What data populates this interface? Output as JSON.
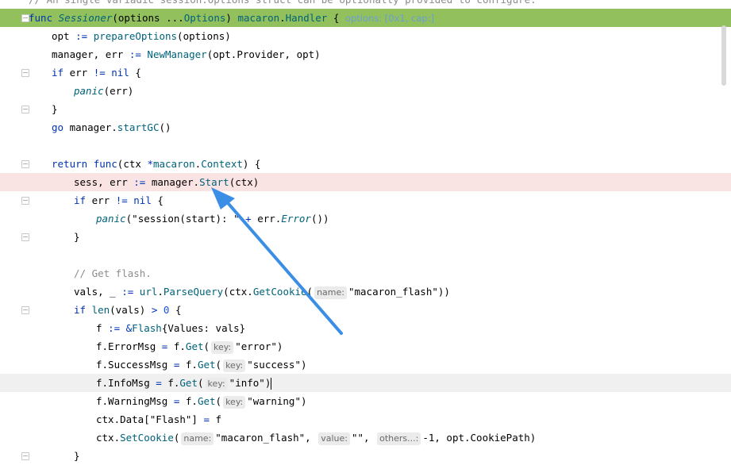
{
  "lines": [
    {
      "id": "l0",
      "tokens": [
        {
          "t": "// An single variadic session.Options struct can be optionally provided to configure.",
          "c": "cmt"
        }
      ]
    },
    {
      "id": "l1",
      "tokens": [
        {
          "t": "func ",
          "c": "kw"
        },
        {
          "t": "Sessioner",
          "c": "fni"
        },
        {
          "t": "(options ...",
          "c": "op"
        },
        {
          "t": "Options",
          "c": "pkg"
        },
        {
          "t": ") ",
          "c": "op"
        },
        {
          "t": "macaron",
          "c": "pkg"
        },
        {
          "t": ".",
          "c": "op"
        },
        {
          "t": "Handler",
          "c": "pkg"
        },
        {
          "t": " { ",
          "c": "op"
        }
      ],
      "hint": "options: [0x1, cap:]"
    },
    {
      "id": "l2",
      "indent": 1,
      "tokens": [
        {
          "t": "opt ",
          "c": "op"
        },
        {
          "t": ":= ",
          "c": "kwo"
        },
        {
          "t": "prepareOptions",
          "c": "call"
        },
        {
          "t": "(options)",
          "c": "op"
        }
      ]
    },
    {
      "id": "l3",
      "indent": 1,
      "tokens": [
        {
          "t": "manager, err ",
          "c": "op"
        },
        {
          "t": ":= ",
          "c": "kwo"
        },
        {
          "t": "NewManager",
          "c": "call"
        },
        {
          "t": "(opt.Provider, opt)",
          "c": "op"
        }
      ]
    },
    {
      "id": "l4",
      "indent": 1,
      "tokens": [
        {
          "t": "if ",
          "c": "kw"
        },
        {
          "t": "err ",
          "c": "op"
        },
        {
          "t": "!= ",
          "c": "kwo"
        },
        {
          "t": "nil",
          "c": "kw"
        },
        {
          "t": " {",
          "c": "op"
        }
      ]
    },
    {
      "id": "l5",
      "indent": 2,
      "tokens": [
        {
          "t": "panic",
          "c": "ital"
        },
        {
          "t": "(err)",
          "c": "op"
        }
      ]
    },
    {
      "id": "l6",
      "indent": 1,
      "tokens": [
        {
          "t": "}",
          "c": "op"
        }
      ]
    },
    {
      "id": "l7",
      "indent": 1,
      "tokens": [
        {
          "t": "go ",
          "c": "kw"
        },
        {
          "t": "manager.",
          "c": "op"
        },
        {
          "t": "startGC",
          "c": "call"
        },
        {
          "t": "()",
          "c": "op"
        }
      ]
    },
    {
      "id": "l8",
      "indent": 0,
      "tokens": []
    },
    {
      "id": "l9",
      "indent": 1,
      "tokens": [
        {
          "t": "return ",
          "c": "kw"
        },
        {
          "t": "func",
          "c": "kw"
        },
        {
          "t": "(ctx ",
          "c": "op"
        },
        {
          "t": "*",
          "c": "kwo"
        },
        {
          "t": "macaron",
          "c": "pkg"
        },
        {
          "t": ".",
          "c": "op"
        },
        {
          "t": "Context",
          "c": "pkg"
        },
        {
          "t": ") {",
          "c": "op"
        }
      ]
    },
    {
      "id": "l10",
      "indent": 2,
      "tokens": [
        {
          "t": "sess, err ",
          "c": "op"
        },
        {
          "t": ":= ",
          "c": "kwo"
        },
        {
          "t": "manager.",
          "c": "op"
        },
        {
          "t": "Start",
          "c": "call"
        },
        {
          "t": "(ctx)",
          "c": "op"
        }
      ]
    },
    {
      "id": "l11",
      "indent": 2,
      "tokens": [
        {
          "t": "if ",
          "c": "kw"
        },
        {
          "t": "err ",
          "c": "op"
        },
        {
          "t": "!= ",
          "c": "kwo"
        },
        {
          "t": "nil",
          "c": "kw"
        },
        {
          "t": " {",
          "c": "op"
        }
      ]
    },
    {
      "id": "l12",
      "indent": 3,
      "tokens": [
        {
          "t": "panic",
          "c": "ital"
        },
        {
          "t": "(\"session(start): \" ",
          "c": "op"
        },
        {
          "t": "+ ",
          "c": "kwo"
        },
        {
          "t": "err.",
          "c": "op"
        },
        {
          "t": "Error",
          "c": "ital"
        },
        {
          "t": "())",
          "c": "op"
        }
      ]
    },
    {
      "id": "l13",
      "indent": 2,
      "tokens": [
        {
          "t": "}",
          "c": "op"
        }
      ]
    },
    {
      "id": "l14",
      "indent": 0,
      "tokens": []
    },
    {
      "id": "l15",
      "indent": 2,
      "tokens": [
        {
          "t": "// Get flash.",
          "c": "cmt"
        }
      ]
    },
    {
      "id": "l16",
      "indent": 2,
      "tokens": [
        {
          "t": "vals, _ ",
          "c": "op"
        },
        {
          "t": ":= ",
          "c": "kwo"
        },
        {
          "t": "url",
          "c": "pkg"
        },
        {
          "t": ".",
          "c": "op"
        },
        {
          "t": "ParseQuery",
          "c": "call"
        },
        {
          "t": "(ctx.",
          "c": "op"
        },
        {
          "t": "GetCookie",
          "c": "call"
        },
        {
          "t": "(",
          "c": "op"
        },
        {
          "h": "name:"
        },
        {
          "t": "\"macaron_flash\"",
          "c": "op"
        },
        {
          "t": "))",
          "c": "op"
        }
      ]
    },
    {
      "id": "l17",
      "indent": 2,
      "tokens": [
        {
          "t": "if ",
          "c": "kw"
        },
        {
          "t": "len",
          "c": "call"
        },
        {
          "t": "(vals) ",
          "c": "op"
        },
        {
          "t": "> ",
          "c": "kwo"
        },
        {
          "t": "0",
          "c": "num"
        },
        {
          "t": " {",
          "c": "op"
        }
      ]
    },
    {
      "id": "l18",
      "indent": 3,
      "tokens": [
        {
          "t": "f ",
          "c": "op"
        },
        {
          "t": ":= ",
          "c": "kwo"
        },
        {
          "t": "&",
          "c": "kwo"
        },
        {
          "t": "Flash",
          "c": "pkg"
        },
        {
          "t": "{Values: vals}",
          "c": "op"
        }
      ]
    },
    {
      "id": "l19",
      "indent": 3,
      "tokens": [
        {
          "t": "f.ErrorMsg ",
          "c": "op"
        },
        {
          "t": "= ",
          "c": "kwo"
        },
        {
          "t": "f.",
          "c": "op"
        },
        {
          "t": "Get",
          "c": "call"
        },
        {
          "t": "(",
          "c": "op"
        },
        {
          "h": "key:"
        },
        {
          "t": "\"error\")",
          "c": "op"
        }
      ]
    },
    {
      "id": "l20",
      "indent": 3,
      "tokens": [
        {
          "t": "f.SuccessMsg ",
          "c": "op"
        },
        {
          "t": "= ",
          "c": "kwo"
        },
        {
          "t": "f.",
          "c": "op"
        },
        {
          "t": "Get",
          "c": "call"
        },
        {
          "t": "(",
          "c": "op"
        },
        {
          "h": "key:"
        },
        {
          "t": "\"success\")",
          "c": "op"
        }
      ]
    },
    {
      "id": "l21",
      "indent": 3,
      "tokens": [
        {
          "t": "f.InfoMsg ",
          "c": "op"
        },
        {
          "t": "= ",
          "c": "kwo"
        },
        {
          "t": "f.",
          "c": "op"
        },
        {
          "t": "Get",
          "c": "call"
        },
        {
          "t": "(",
          "c": "op"
        },
        {
          "h": "key:"
        },
        {
          "t": "\"info\")",
          "c": "op"
        },
        {
          "caret": true
        }
      ]
    },
    {
      "id": "l22",
      "indent": 3,
      "tokens": [
        {
          "t": "f.WarningMsg ",
          "c": "op"
        },
        {
          "t": "= ",
          "c": "kwo"
        },
        {
          "t": "f.",
          "c": "op"
        },
        {
          "t": "Get",
          "c": "call"
        },
        {
          "t": "(",
          "c": "op"
        },
        {
          "h": "key:"
        },
        {
          "t": "\"warning\")",
          "c": "op"
        }
      ]
    },
    {
      "id": "l23",
      "indent": 3,
      "tokens": [
        {
          "t": "ctx.Data[\"Flash\"] ",
          "c": "op"
        },
        {
          "t": "= ",
          "c": "kwo"
        },
        {
          "t": "f",
          "c": "op"
        }
      ]
    },
    {
      "id": "l24",
      "indent": 3,
      "tokens": [
        {
          "t": "ctx.",
          "c": "op"
        },
        {
          "t": "SetCookie",
          "c": "call"
        },
        {
          "t": "(",
          "c": "op"
        },
        {
          "h": "name:"
        },
        {
          "t": "\"macaron_flash\", ",
          "c": "op"
        },
        {
          "h": "value:"
        },
        {
          "t": "\"\", ",
          "c": "op"
        },
        {
          "h": "others...:"
        },
        {
          "t": "-1, opt.CookiePath)",
          "c": "op"
        }
      ]
    },
    {
      "id": "l25",
      "indent": 2,
      "tokens": [
        {
          "t": "}",
          "c": "op"
        }
      ]
    }
  ]
}
